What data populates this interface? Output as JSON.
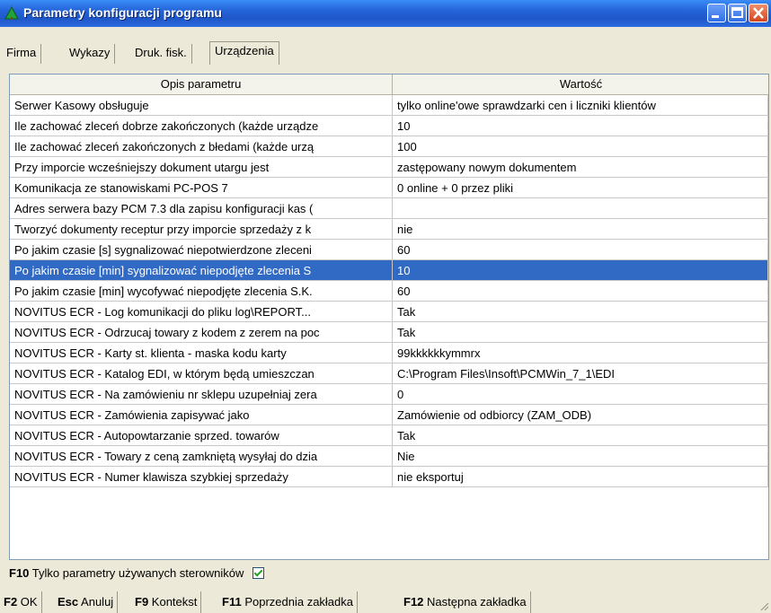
{
  "window": {
    "title": "Parametry konfiguracji programu"
  },
  "tabs": [
    "Firma",
    "Wykazy",
    "Druk. fisk.",
    "Urządzenia"
  ],
  "grid": {
    "headers": [
      "Opis parametru",
      "Wartość"
    ],
    "rows": [
      [
        "Serwer Kasowy obsługuje",
        "tylko online'owe sprawdzarki cen i liczniki klientów"
      ],
      [
        "Ile zachować zleceń dobrze zakończonych (każde urządze",
        "10"
      ],
      [
        "Ile zachować zleceń zakończonych z błedami (każde urzą",
        "100"
      ],
      [
        "Przy imporcie wcześniejszy dokument utargu jest",
        "zastępowany nowym dokumentem"
      ],
      [
        "Komunikacja ze stanowiskami PC-POS 7",
        "0 online + 0 przez pliki"
      ],
      [
        "Adres serwera bazy PCM 7.3 dla zapisu konfiguracji kas (",
        ""
      ],
      [
        "Tworzyć dokumenty receptur przy imporcie sprzedaży z k",
        "nie"
      ],
      [
        "Po jakim czasie [s] sygnalizować niepotwierdzone zleceni",
        "60"
      ],
      [
        "Po jakim czasie [min] sygnalizować niepodjęte zlecenia S",
        "10"
      ],
      [
        "Po jakim czasie [min] wycofywać niepodjęte zlecenia S.K.",
        "60"
      ],
      [
        "NOVITUS ECR - Log komunikacji do pliku log\\REPORT...",
        "Tak"
      ],
      [
        "NOVITUS ECR - Odrzucaj towary z kodem z zerem na poc",
        "Tak"
      ],
      [
        "NOVITUS ECR - Karty st. klienta - maska kodu karty",
        "99kkkkkkymmrx"
      ],
      [
        "NOVITUS ECR - Katalog EDI, w którym będą umieszczan",
        "C:\\Program Files\\Insoft\\PCMWin_7_1\\EDI"
      ],
      [
        "NOVITUS ECR - Na zamówieniu nr sklepu uzupełniaj zera",
        "0"
      ],
      [
        "NOVITUS ECR - Zamówienia zapisywać jako",
        "Zamówienie od odbiorcy (ZAM_ODB)"
      ],
      [
        "NOVITUS ECR - Autopowtarzanie sprzed. towarów",
        "Tak"
      ],
      [
        "NOVITUS ECR - Towary z ceną zamkniętą wysyłaj do dzia",
        "Nie"
      ],
      [
        "NOVITUS ECR - Numer klawisza szybkiej sprzedaży",
        "nie eksportuj"
      ]
    ],
    "selected_row": 8
  },
  "option": {
    "key": "F10",
    "label": "Tylko parametry używanych sterowników",
    "checked": true
  },
  "statusbar": [
    {
      "key": "F2",
      "label": "OK"
    },
    {
      "key": "Esc",
      "label": "Anuluj"
    },
    {
      "key": "F9",
      "label": "Kontekst"
    },
    {
      "key": "F11",
      "label": "Poprzednia zakładka"
    },
    {
      "key": "F12",
      "label": "Następna zakładka"
    }
  ],
  "colors": {
    "selection": "#316ac5",
    "titlebar": "#2463d8"
  }
}
